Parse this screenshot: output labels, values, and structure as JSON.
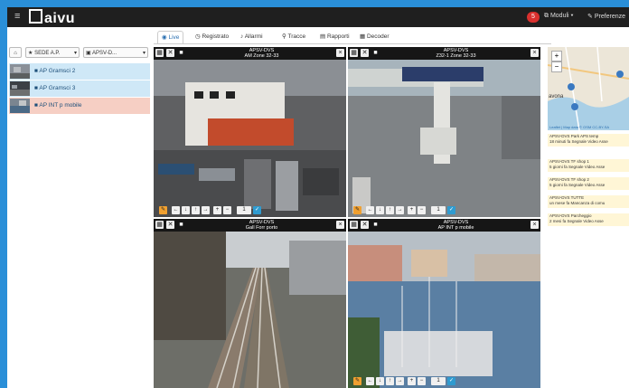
{
  "app": {
    "logo": "aivu",
    "badge": "5",
    "nav_moduli": "Moduli",
    "nav_preferenze": "Preferenze"
  },
  "tabs": [
    {
      "label": "Live"
    },
    {
      "label": "Registrato"
    },
    {
      "label": "Allarmi"
    },
    {
      "label": "Tracce"
    },
    {
      "label": "Rapporti"
    },
    {
      "label": "Decoder"
    }
  ],
  "filters": {
    "home": "⌂",
    "site": "SEDE A.P.",
    "group": "APSV-D..."
  },
  "cameras": [
    {
      "label": "AP Gramsci 2",
      "bg": "#cfe8f7"
    },
    {
      "label": "AP Gramsci 3",
      "bg": "#cfe8f7"
    },
    {
      "label": "AP INT p mobile",
      "bg": "#f6cfc4"
    }
  ],
  "tiles": [
    {
      "line1": "APSV-DVS",
      "line2": "AM Zone 32-33",
      "preset": "1"
    },
    {
      "line1": "APSV-DVS",
      "line2": "Z32-1 Zone 32-33",
      "preset": "1"
    },
    {
      "line1": "APSV-DVS",
      "line2": "Gall Forr porto",
      "preset": "1"
    },
    {
      "line1": "APSV-DVS",
      "line2": "AP INT p mobile",
      "preset": "1"
    }
  ],
  "map": {
    "attribution": "Leaflet | Map data © OSM CC-BY-SA",
    "town": "avona",
    "zoom_in": "+",
    "zoom_out": "−"
  },
  "alerts": [
    {
      "line1": "APSV-DVS  Park APS temp",
      "line2": "18 minuti fa  Segnale Video Asse"
    },
    {
      "line1": "APSV-DVS  TF shop 1",
      "line2": "5 giorni fa  Segnale Video Asse"
    },
    {
      "line1": "APSV-DVS  TF shop 2",
      "line2": "5 giorni fa  Segnale Video Asse"
    },
    {
      "line1": "APSV-DVS  TUTTE",
      "line2": "un mese fa  Mancanza di comu"
    },
    {
      "line1": "APSV-DVS  Parcheggio",
      "line2": "2 mesi fa  Segnale Video Asse"
    }
  ],
  "colors": {
    "accent": "#2a8fd8",
    "topbar": "#1f1f1f",
    "warn": "#f0a030",
    "ok": "#2f9bd0",
    "alert_bg": "#fff6d6"
  }
}
